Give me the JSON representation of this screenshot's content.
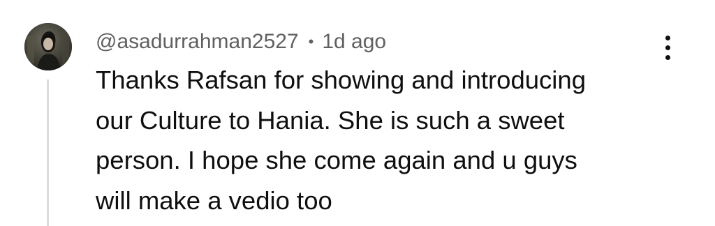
{
  "comment": {
    "author": "@asadurrahman2527",
    "separator": "•",
    "time": "1d ago",
    "text_lines": [
      "Thanks Rafsan for showing and introducing",
      "our Culture to Hania. She is such a sweet",
      "person. I hope she come again and u guys",
      "will make a vedio too"
    ],
    "avatar_icon": "user-avatar-photo",
    "menu_icon": "more-vert-icon"
  },
  "colors": {
    "text": "#0f0f0f",
    "meta": "#606060",
    "thread_line": "#dcdcdc"
  }
}
